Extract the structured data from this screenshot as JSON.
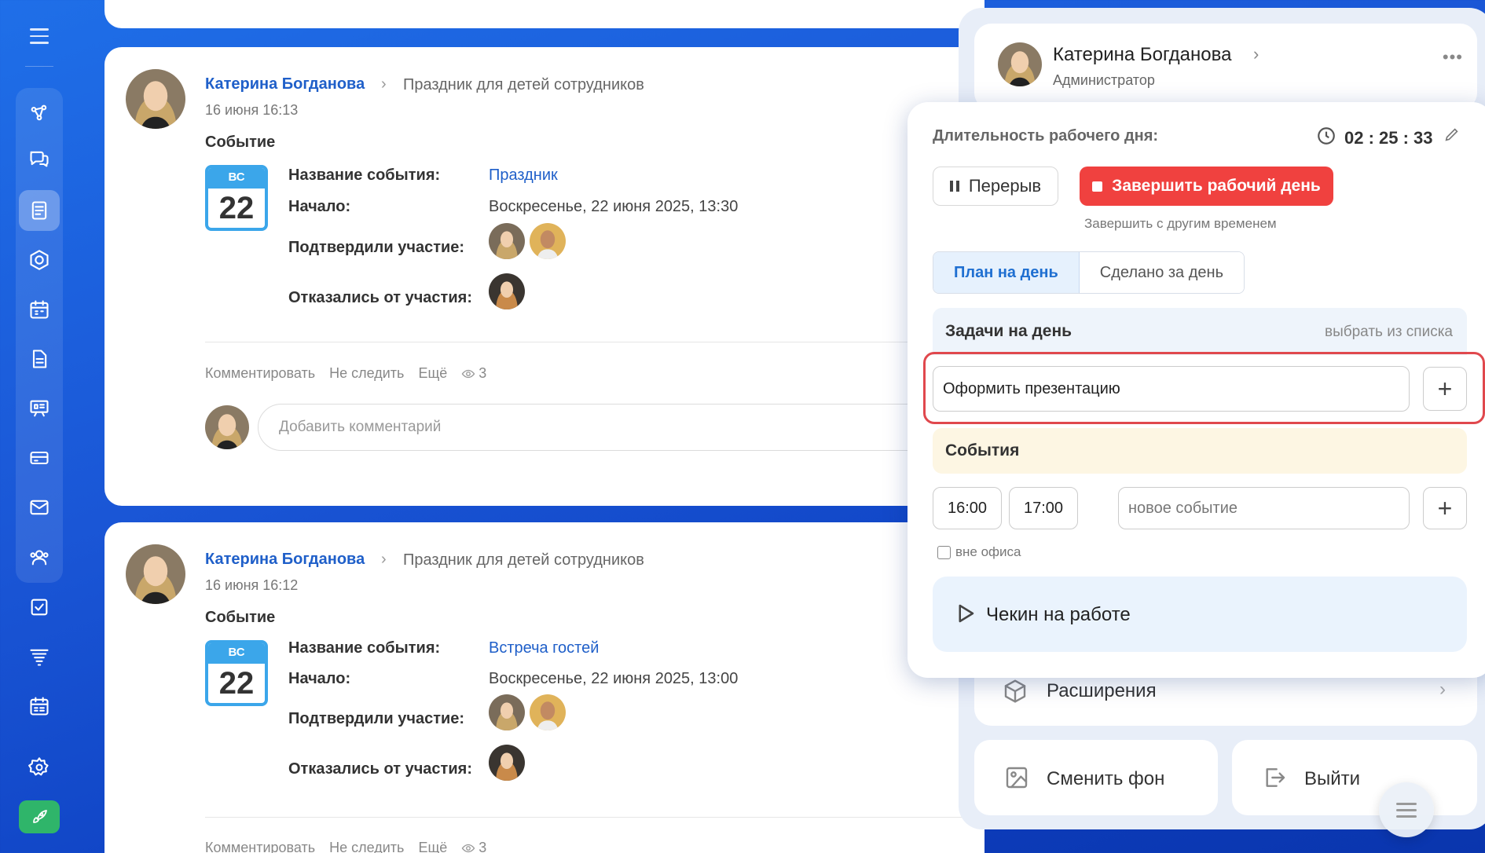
{
  "sidebar": {
    "icons": [
      "menu-icon",
      "network-icon",
      "chat-icon",
      "feed-icon",
      "hexagon-icon",
      "calendar-icon",
      "document-icon",
      "presentation-icon",
      "card-icon",
      "mail-icon",
      "users-icon",
      "tasks-icon",
      "funnel-icon",
      "schedule-icon",
      "settings-icon",
      "rocket-icon"
    ],
    "active": "feed-icon"
  },
  "posts": [
    {
      "author": "Катерина Богданова",
      "destination": "Праздник для детей сотрудников",
      "date": "16 июня 16:13",
      "type": "Событие",
      "calendar": {
        "dow": "ВС",
        "day": "22"
      },
      "name_label": "Название события:",
      "name_value": "Праздник",
      "start_label": "Начало:",
      "start_value": "Воскресенье, 22 июня 2025, 13:30",
      "confirmed_label": "Подтвердили участие:",
      "declined_label": "Отказались от участия:"
    },
    {
      "author": "Катерина Богданова",
      "destination": "Праздник для детей сотрудников",
      "date": "16 июня 16:12",
      "type": "Событие",
      "calendar": {
        "dow": "ВС",
        "day": "22"
      },
      "name_label": "Название события:",
      "name_value": "Встреча гостей",
      "start_label": "Начало:",
      "start_value": "Воскресенье, 22 июня 2025, 13:00",
      "confirmed_label": "Подтвердили участие:",
      "declined_label": "Отказались от участия:"
    }
  ],
  "post_actions": {
    "comment": "Комментировать",
    "unfollow": "Не следить",
    "more": "Ещё",
    "views": "3",
    "comment_placeholder": "Добавить комментарий"
  },
  "profile": {
    "name": "Катерина Богданова",
    "role": "Администратор",
    "more": "•••",
    "extensions": "Расширения",
    "change_bg": "Сменить фон",
    "logout": "Выйти"
  },
  "workday": {
    "title": "Длительность рабочего дня:",
    "timer": "02 : 25 : 33",
    "pause": "Перерыв",
    "end_day": "Завершить рабочий день",
    "end_other": "Завершить с другим временем",
    "tabs": [
      "План на день",
      "Сделано за день"
    ],
    "active_tab": 0,
    "tasks_title": "Задачи на день",
    "tasks_pick": "выбрать из списка",
    "task_value": "Оформить презентацию",
    "events_title": "События",
    "event_start": "16:00",
    "event_end": "17:00",
    "event_placeholder": "новое событие",
    "out_of_office": "вне офиса",
    "checkin": "Чекин на работе",
    "accent": "#f0413f",
    "highlight": "#e0484d"
  }
}
